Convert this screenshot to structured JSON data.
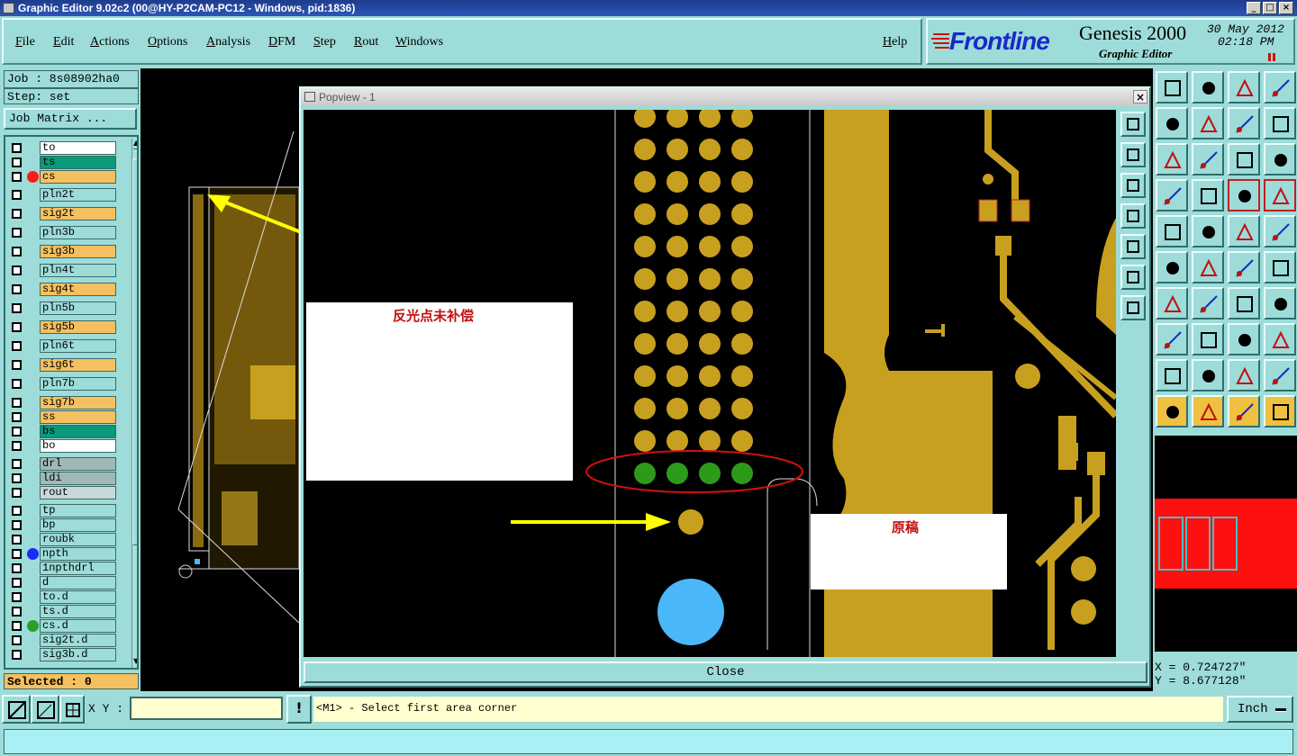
{
  "window": {
    "title": "Graphic Editor 9.02c2 (00@HY-P2CAM-PC12 - Windows, pid:1836)"
  },
  "menu": {
    "items": [
      "File",
      "Edit",
      "Actions",
      "Options",
      "Analysis",
      "DFM",
      "Step",
      "Rout",
      "Windows"
    ],
    "help": "Help"
  },
  "brand": {
    "logo": "Frontline",
    "product": "Genesis 2000",
    "subtitle": "Graphic Editor",
    "date": "30 May 2012",
    "time": "02:18 PM"
  },
  "job": {
    "job_label": "Job : 8s08902ha0",
    "step_label": "Step: set",
    "matrix_button": "Job Matrix ...",
    "selected": "Selected : 0"
  },
  "layers": [
    {
      "name": "to",
      "color": "#ffffff"
    },
    {
      "name": "ts",
      "color": "#0a9a7a"
    },
    {
      "name": "cs",
      "color": "#f5c060",
      "dot": "#ff1a1a"
    },
    {
      "name": "pln2t",
      "color": "#9ddcd8"
    },
    {
      "name": "sig2t",
      "color": "#f5c060"
    },
    {
      "name": "pln3b",
      "color": "#9ddcd8"
    },
    {
      "name": "sig3b",
      "color": "#f5c060"
    },
    {
      "name": "pln4t",
      "color": "#9ddcd8"
    },
    {
      "name": "sig4t",
      "color": "#f5c060"
    },
    {
      "name": "pln5b",
      "color": "#9ddcd8"
    },
    {
      "name": "sig5b",
      "color": "#f5c060"
    },
    {
      "name": "pln6t",
      "color": "#9ddcd8"
    },
    {
      "name": "sig6t",
      "color": "#f5c060"
    },
    {
      "name": "pln7b",
      "color": "#9ddcd8"
    },
    {
      "name": "sig7b",
      "color": "#f5c060"
    },
    {
      "name": "ss",
      "color": "#f5c060"
    },
    {
      "name": "bs",
      "color": "#0a9a7a"
    },
    {
      "name": "bo",
      "color": "#ffffff"
    },
    {
      "name": "drl",
      "color": "#a0b8b8"
    },
    {
      "name": "ldi",
      "color": "#a0b8b8"
    },
    {
      "name": "rout",
      "color": "#c8d8d8"
    },
    {
      "name": "tp",
      "color": "#9ddcd8"
    },
    {
      "name": "bp",
      "color": "#9ddcd8"
    },
    {
      "name": "roubk",
      "color": "#9ddcd8"
    },
    {
      "name": "npth",
      "color": "#9ddcd8",
      "dot": "#1a2aff"
    },
    {
      "name": "1npthdrl",
      "color": "#9ddcd8"
    },
    {
      "name": "d",
      "color": "#9ddcd8"
    },
    {
      "name": "to.d",
      "color": "#9ddcd8"
    },
    {
      "name": "ts.d",
      "color": "#9ddcd8"
    },
    {
      "name": "cs.d",
      "color": "#9ddcd8",
      "dot": "#2aa02a"
    },
    {
      "name": "sig2t.d",
      "color": "#9ddcd8"
    },
    {
      "name": "sig3b.d",
      "color": "#9ddcd8"
    }
  ],
  "popview": {
    "title": "Popview - 1",
    "close_label": "Close",
    "annotation_left": "反光点未补偿",
    "annotation_right": "原稿"
  },
  "coords": {
    "x": "X = 0.724727\"",
    "y": "Y = 8.677128\""
  },
  "status": {
    "xy_label": "X Y :",
    "xy_value": "",
    "message": "<M1> - Select first area corner",
    "units": "Inch"
  },
  "colors": {
    "copper": "#c8a020",
    "pad_green": "#2e9a1a",
    "hole_blue": "#4ab8f8",
    "bg": "#9ddcd8"
  }
}
